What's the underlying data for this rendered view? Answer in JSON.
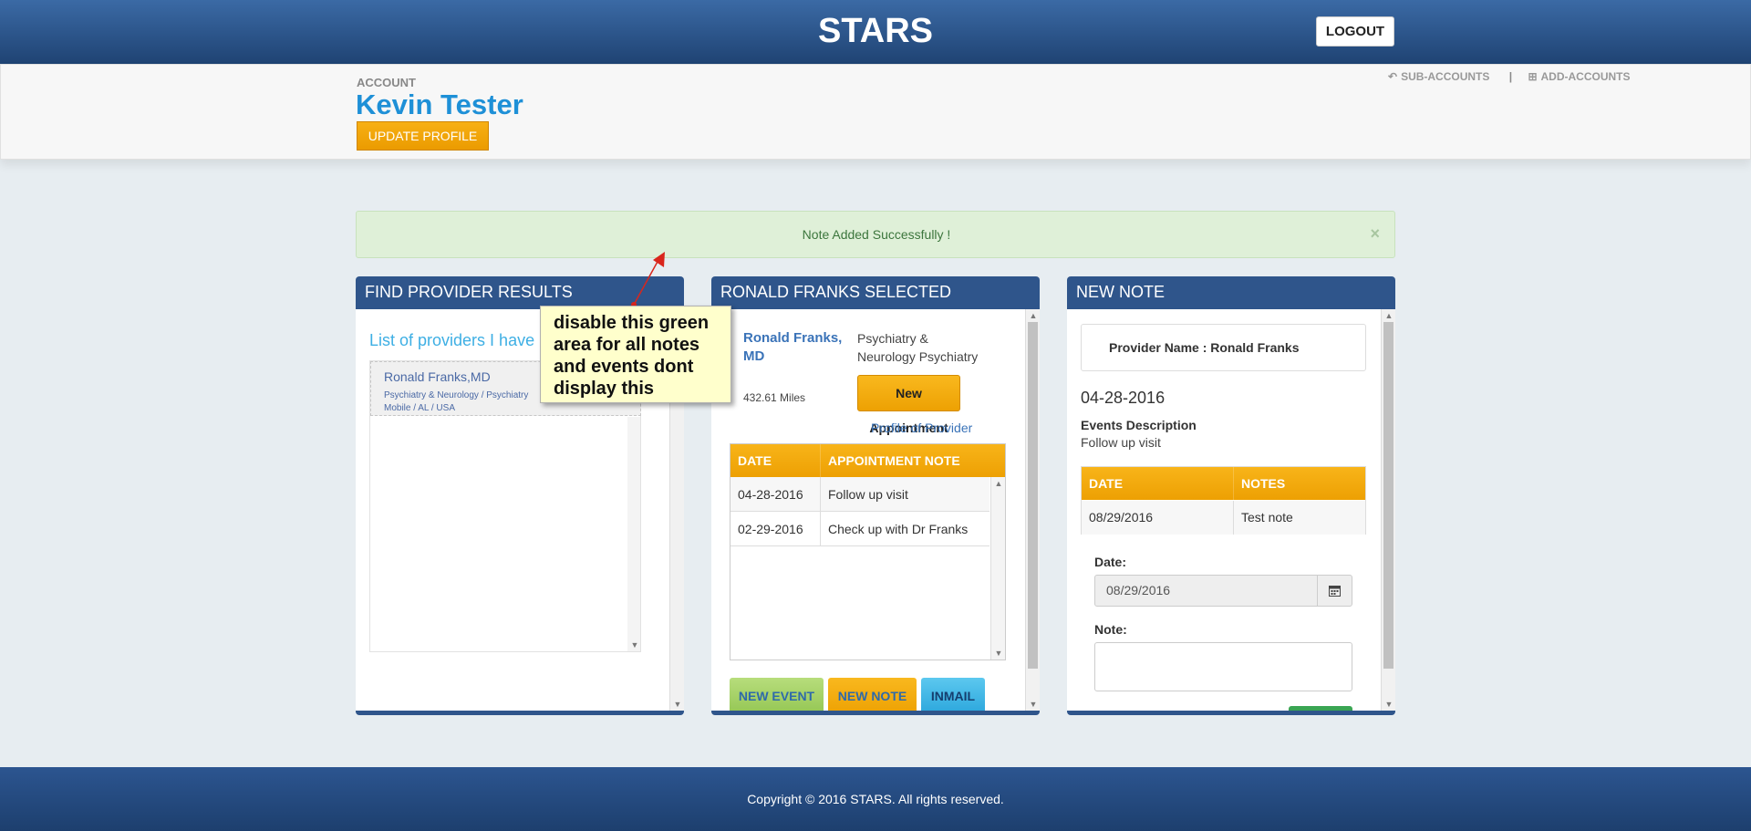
{
  "header": {
    "title": "STARS",
    "logout_label": "LOGOUT"
  },
  "account": {
    "label": "ACCOUNT",
    "name": "Kevin Tester",
    "update_label": "UPDATE PROFILE",
    "sub_accounts_label": "SUB-ACCOUNTS",
    "separator": "|",
    "add_accounts_label": "ADD-ACCOUNTS"
  },
  "alert": {
    "message": "Note Added Successfully !",
    "close": "×"
  },
  "panel_results": {
    "title": "FIND PROVIDER RESULTS",
    "list_link": "List of providers I have",
    "providers": [
      {
        "name": "Ronald Franks,MD",
        "specialty": "Psychiatry & Neurology / Psychiatry",
        "location": "Mobile / AL / USA"
      }
    ]
  },
  "panel_selected": {
    "title": "RONALD FRANKS SELECTED",
    "provider_name_line1": "Ronald Franks,",
    "provider_name_line2": "MD",
    "specialty_line1": "Psychiatry &",
    "specialty_line2": "Neurology Psychiatry",
    "distance": "432.61 Miles",
    "new_appointment_label": "New Appointment",
    "profile_link": "Profile of Provider",
    "columns": [
      "DATE",
      "APPOINTMENT NOTE"
    ],
    "rows": [
      {
        "date": "04-28-2016",
        "note": "Follow up visit"
      },
      {
        "date": "02-29-2016",
        "note": "Check up with Dr Franks"
      }
    ],
    "buttons": {
      "new_event": "NEW EVENT",
      "new_note": "NEW NOTE",
      "inmail": "INMAIL"
    }
  },
  "panel_note": {
    "title": "NEW NOTE",
    "provider_label": "Provider Name : Ronald Franks",
    "event_date": "04-28-2016",
    "events_description_label": "Events Description",
    "events_description_value": "Follow up visit",
    "columns": [
      "DATE",
      "NOTES"
    ],
    "rows": [
      {
        "date": "08/29/2016",
        "note": "Test note"
      }
    ],
    "date_label": "Date:",
    "date_value": "08/29/2016",
    "note_label": "Note:",
    "note_value": ""
  },
  "callout": {
    "text": "disable this green area for all notes and events dont display this"
  },
  "footer": {
    "copyright": "Copyright © 2016 STARS. All rights reserved."
  },
  "colors": {
    "header_blue": "#2f558b",
    "accent_orange": "#f5a90f",
    "alert_green": "#dff0d8",
    "link_blue": "#3a73b8"
  },
  "icons": {
    "sub_accounts": "reply-icon",
    "add_accounts": "plus-square-icon",
    "calendar": "calendar-icon",
    "close": "close-icon"
  }
}
